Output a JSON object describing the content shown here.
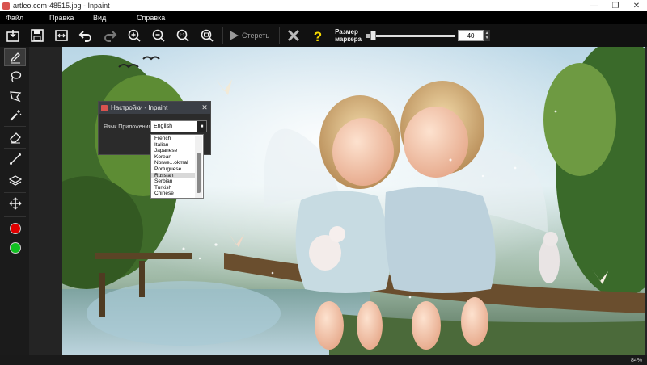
{
  "window": {
    "title": "artleo.com-48515.jpg - Inpaint",
    "controls": [
      "minimize-icon",
      "maximize-icon",
      "close-icon"
    ]
  },
  "menu": [
    "Файл",
    "Правка",
    "Вид",
    "Справка"
  ],
  "toolbar": {
    "erase_label": "Стереть",
    "marker_size_label_1": "Размер",
    "marker_size_label_2": "маркера",
    "marker_size_value": "40",
    "marker_size_fraction": 0.06
  },
  "tools": [
    {
      "name": "marker-tool",
      "icon": "pencil-icon"
    },
    {
      "name": "lasso-tool",
      "icon": "lasso-icon"
    },
    {
      "name": "polygonal-lasso-tool",
      "icon": "polygon-lasso-icon"
    },
    {
      "name": "magic-wand-tool",
      "icon": "magic-wand-icon"
    },
    {
      "name": "eraser-tool",
      "icon": "eraser-icon"
    },
    {
      "name": "line-tool",
      "icon": "line-icon"
    },
    {
      "name": "layers-tool",
      "icon": "layers-icon"
    },
    {
      "name": "move-tool",
      "icon": "move-icon"
    }
  ],
  "colors": {
    "red": "#e00000",
    "green": "#10c020"
  },
  "status": {
    "zoom": "84%"
  },
  "dialog": {
    "title": "Настройки - Inpaint",
    "language_label": "Язык Приложения",
    "selected_language": "English",
    "languages": [
      "French",
      "Italian",
      "Japanese",
      "Korean",
      "Norwe...okmal",
      "Portuguese",
      "Russian",
      "Serbian",
      "Turkish",
      "Chinese"
    ],
    "highlighted": "Russian"
  }
}
